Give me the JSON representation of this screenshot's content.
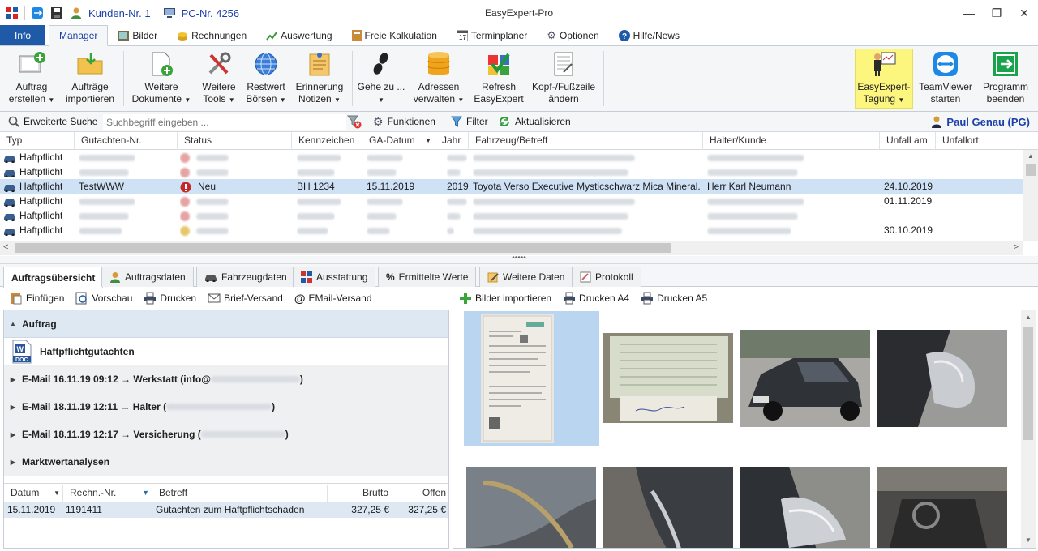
{
  "titlebar": {
    "customer": "Kunden-Nr. 1",
    "pc": "PC-Nr. 4256",
    "app_title": "EasyExpert-Pro"
  },
  "menu_tabs": [
    {
      "label": "Info"
    },
    {
      "label": "Manager"
    },
    {
      "label": "Bilder"
    },
    {
      "label": "Rechnungen"
    },
    {
      "label": "Auswertung"
    },
    {
      "label": "Freie Kalkulation"
    },
    {
      "label": "Terminplaner"
    },
    {
      "label": "Optionen"
    },
    {
      "label": "Hilfe/News"
    }
  ],
  "ribbon": {
    "auftrag_erstellen": [
      "Auftrag",
      "erstellen"
    ],
    "auftraege_importieren": [
      "Aufträge",
      "importieren"
    ],
    "weitere_dokumente": [
      "Weitere",
      "Dokumente"
    ],
    "weitere_tools": [
      "Weitere",
      "Tools"
    ],
    "restwert_boersen": [
      "Restwert",
      "Börsen"
    ],
    "erinnerung_notizen": [
      "Erinnerung",
      "Notizen"
    ],
    "gehe_zu": [
      "Gehe zu ...",
      ""
    ],
    "adressen_verwalten": [
      "Adressen",
      "verwalten"
    ],
    "refresh_easyexpert": [
      "Refresh",
      "EasyExpert"
    ],
    "kopf_fusszeile": [
      "Kopf-/Fußzeile",
      "ändern"
    ],
    "easyexpert_tagung": [
      "EasyExpert-",
      "Tagung"
    ],
    "teamviewer_starten": [
      "TeamViewer",
      "starten"
    ],
    "programm_beenden": [
      "Programm",
      "beenden"
    ]
  },
  "searchbar": {
    "label": "Erweiterte Suche",
    "placeholder": "Suchbegriff eingeben ...",
    "funktionen": "Funktionen",
    "filter": "Filter",
    "aktualisieren": "Aktualisieren",
    "user": "Paul Genau (PG)"
  },
  "grid": {
    "columns": [
      "Typ",
      "Gutachten-Nr.",
      "Status",
      "Kennzeichen",
      "GA-Datum",
      "Jahr",
      "Fahrzeug/Betreff",
      "Halter/Kunde",
      "Unfall am",
      "Unfallort"
    ],
    "rows": [
      {
        "typ": "Haftpflicht",
        "nr": "",
        "status": "",
        "kennz": "",
        "datum": "",
        "jahr": "",
        "fahrzeug": "",
        "halter": "",
        "unfall": ""
      },
      {
        "typ": "Haftpflicht",
        "nr": "",
        "status": "",
        "kennz": "",
        "datum": "",
        "jahr": "",
        "fahrzeug": "",
        "halter": "",
        "unfall": ""
      },
      {
        "typ": "Haftpflicht",
        "nr": "TestWWW",
        "status": "Neu",
        "kennz": "BH 1234",
        "datum": "15.11.2019",
        "jahr": "2019",
        "fahrzeug": "Toyota Verso Executive Mysticschwarz Mica Mineral...",
        "halter": "Herr Karl Neumann",
        "unfall": "24.10.2019"
      },
      {
        "typ": "Haftpflicht",
        "nr": "",
        "status": "",
        "kennz": "",
        "datum": "",
        "jahr": "",
        "fahrzeug": "",
        "halter": "",
        "unfall": "01.11.2019"
      },
      {
        "typ": "Haftpflicht",
        "nr": "",
        "status": "",
        "kennz": "",
        "datum": "",
        "jahr": "",
        "fahrzeug": "",
        "halter": "",
        "unfall": ""
      },
      {
        "typ": "Haftpflicht",
        "nr": "",
        "status": "",
        "kennz": "",
        "datum": "",
        "jahr": "",
        "fahrzeug": "",
        "halter": "",
        "unfall": "30.10.2019"
      }
    ]
  },
  "lower_tabs": [
    {
      "label": "Auftragsübersicht"
    },
    {
      "label": "Auftragsdaten"
    },
    {
      "label": "Fahrzeugdaten"
    },
    {
      "label": "Ausstattung"
    },
    {
      "label": "Ermittelte Werte"
    },
    {
      "label": "Weitere Daten"
    },
    {
      "label": "Protokoll"
    }
  ],
  "left_toolbar": {
    "einfuegen": "Einfügen",
    "vorschau": "Vorschau",
    "drucken": "Drucken",
    "brief": "Brief-Versand",
    "email": "EMail-Versand"
  },
  "right_toolbar": {
    "bilder_importieren": "Bilder importieren",
    "drucken_a4": "Drucken A4",
    "drucken_a5": "Drucken A5"
  },
  "tree": {
    "auftrag": "Auftrag",
    "doc": "Haftpflichtgutachten",
    "doc_badge": "DOC",
    "mail1": "E-Mail 16.11.19 09:12 → Werkstatt (info@",
    "mail1_end": ")",
    "mail2": "E-Mail 18.11.19 12:11 → Halter (",
    "mail2_end": ")",
    "mail3": "E-Mail 18.11.19 12:17 → Versicherung (",
    "mail3_end": ")",
    "markt": "Marktwertanalysen"
  },
  "invoice": {
    "columns": [
      "Datum",
      "Rechn.-Nr.",
      "Betreff",
      "Brutto",
      "Offen"
    ],
    "rows": [
      {
        "datum": "15.11.2019",
        "nr": "1191411",
        "betreff": "Gutachten zum Haftpflichtschaden",
        "brutto": "327,25 €",
        "offen": "327,25 €"
      }
    ]
  },
  "colors": {
    "accent": "#1e5aa8",
    "selection": "#cfe2f5",
    "highlight": "#fdf67e"
  }
}
